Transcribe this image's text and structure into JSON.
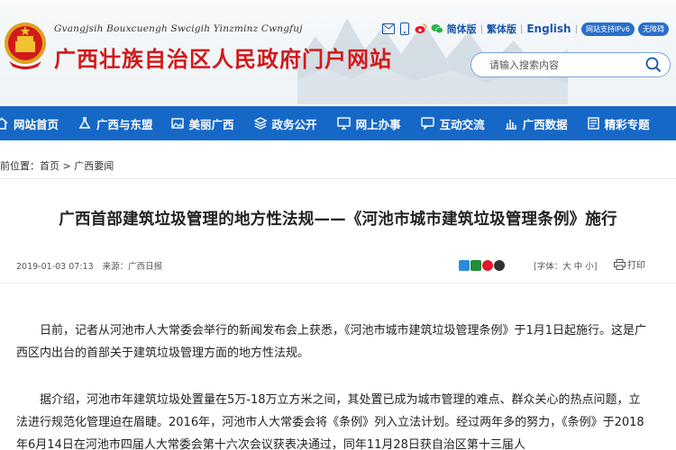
{
  "header": {
    "subtitle": "Gvangjsih Bouxcuengh Swcigih Yinzminz Cwngfuj",
    "title": "广西壮族自治区人民政府门户网站"
  },
  "toolbar": {
    "simplified": "简体版",
    "traditional": "繁体版",
    "english": "English",
    "ipv6_badge": "网站支持IPv6",
    "accessible_badge": "无障碍"
  },
  "search": {
    "placeholder": "请输入搜索内容"
  },
  "nav": {
    "items": [
      {
        "label": "网站首页"
      },
      {
        "label": "广西与东盟"
      },
      {
        "label": "美丽广西"
      },
      {
        "label": "政务公开"
      },
      {
        "label": "网上办事"
      },
      {
        "label": "互动交流"
      },
      {
        "label": "广西数据"
      },
      {
        "label": "精彩专题"
      }
    ]
  },
  "breadcrumb": {
    "prefix": "前位置：",
    "home": "首页",
    "separator": ">",
    "section": "广西要闻"
  },
  "article": {
    "title": "广西首部建筑垃圾管理的地方性法规——《河池市城市建筑垃圾管理条例》施行",
    "datetime": "2019-01-03 07:13",
    "source": "来源：广西日报",
    "font_size_label": "[字体：大 中 小]",
    "print_label": "打印",
    "paragraph1": "日前，记者从河池市人大常委会举行的新闻发布会上获悉，《河池市城市建筑垃圾管理条例》于1月1日起施行。这是广西区内出台的首部关于建筑垃圾管理方面的地方性法规。",
    "paragraph2": "据介绍，河池市年建筑垃圾处置量在5万-18万立方米之间，其处置已成为城市管理的难点、群众关心的热点问题，立法进行规范化管理迫在眉睫。2016年，河池市人大常委会将《条例》列入立法计划。经过两年多的努力，《条例》于2018年6月14日在河池市四届人大常委会第十六次会议获表决通过，同年11月28日获自治区第十三届人"
  },
  "colors": {
    "brand_red": "#d11a1a",
    "nav_blue": "#1668c7",
    "link_blue": "#1a56a8"
  }
}
